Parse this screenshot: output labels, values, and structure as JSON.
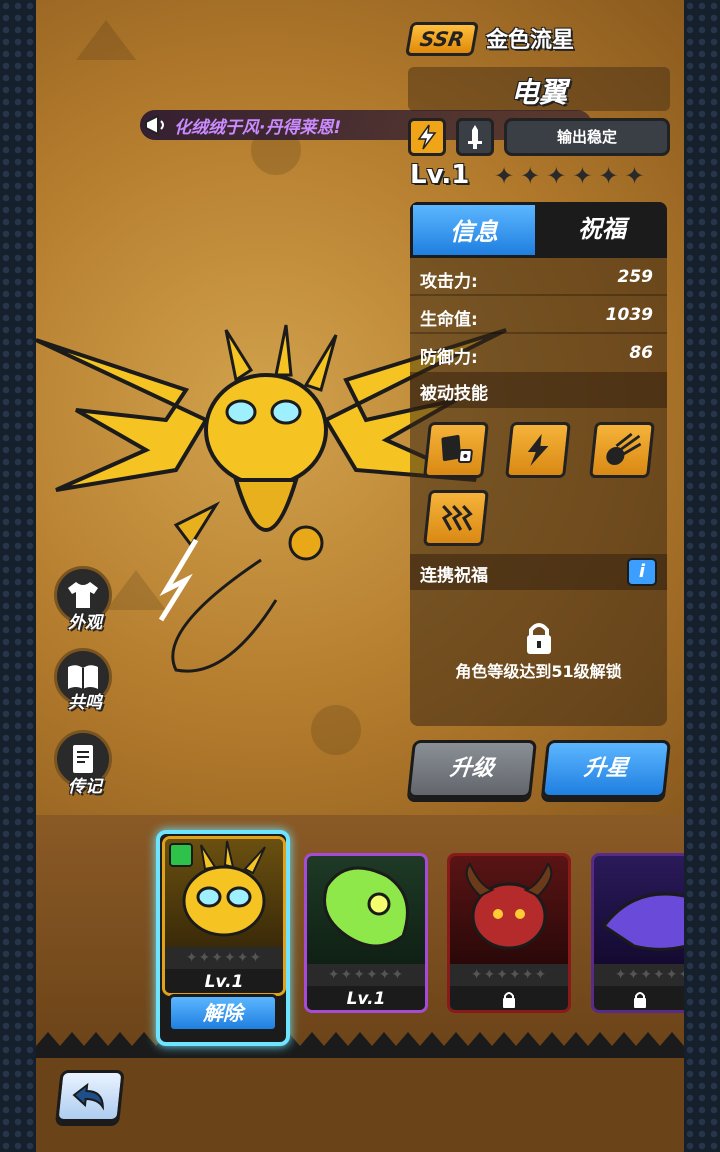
{
  "hero": {
    "rarity": "SSR",
    "subtitle": "金色流星",
    "name": "电翼",
    "tag_label": "输出稳定",
    "level": "Lv.1",
    "stars_total": 6,
    "stars_filled": 0
  },
  "announcement": {
    "text": "化绒绒于风·丹得莱恩!"
  },
  "tabs": {
    "info": "信息",
    "bless": "祝福"
  },
  "stats": [
    {
      "label": "攻击力:",
      "value": "259"
    },
    {
      "label": "生命值:",
      "value": "1039"
    },
    {
      "label": "防御力:",
      "value": "86"
    }
  ],
  "passive": {
    "title": "被动技能",
    "skills": [
      "cards-dice-icon",
      "lightning-burst-icon",
      "meteor-icon",
      "triple-lightning-icon"
    ]
  },
  "link_bless": {
    "title": "连携祝福",
    "info_label": "i",
    "locked_text": "角色等级达到51级解锁"
  },
  "buttons": {
    "upgrade": "升级",
    "star_up": "升星"
  },
  "side_menu": [
    {
      "label": "外观",
      "icon": "shirt-icon"
    },
    {
      "label": "共鸣",
      "icon": "book-icon"
    },
    {
      "label": "传记",
      "icon": "journal-icon"
    }
  ],
  "roster": [
    {
      "name": "electric-wing",
      "level": "Lv.1",
      "locked": false,
      "selected": true,
      "action": "解除"
    },
    {
      "name": "green-ghost",
      "level": "Lv.1",
      "locked": false,
      "selected": false
    },
    {
      "name": "red-demon",
      "level": "",
      "locked": true,
      "selected": false
    },
    {
      "name": "purple-dragon",
      "level": "",
      "locked": true,
      "selected": false
    }
  ],
  "colors": {
    "accent_blue": "#1f7fe0",
    "gold": "#f0a418",
    "announcement_purple": "#c98bff",
    "selected_frame": "#6ee4ff"
  }
}
